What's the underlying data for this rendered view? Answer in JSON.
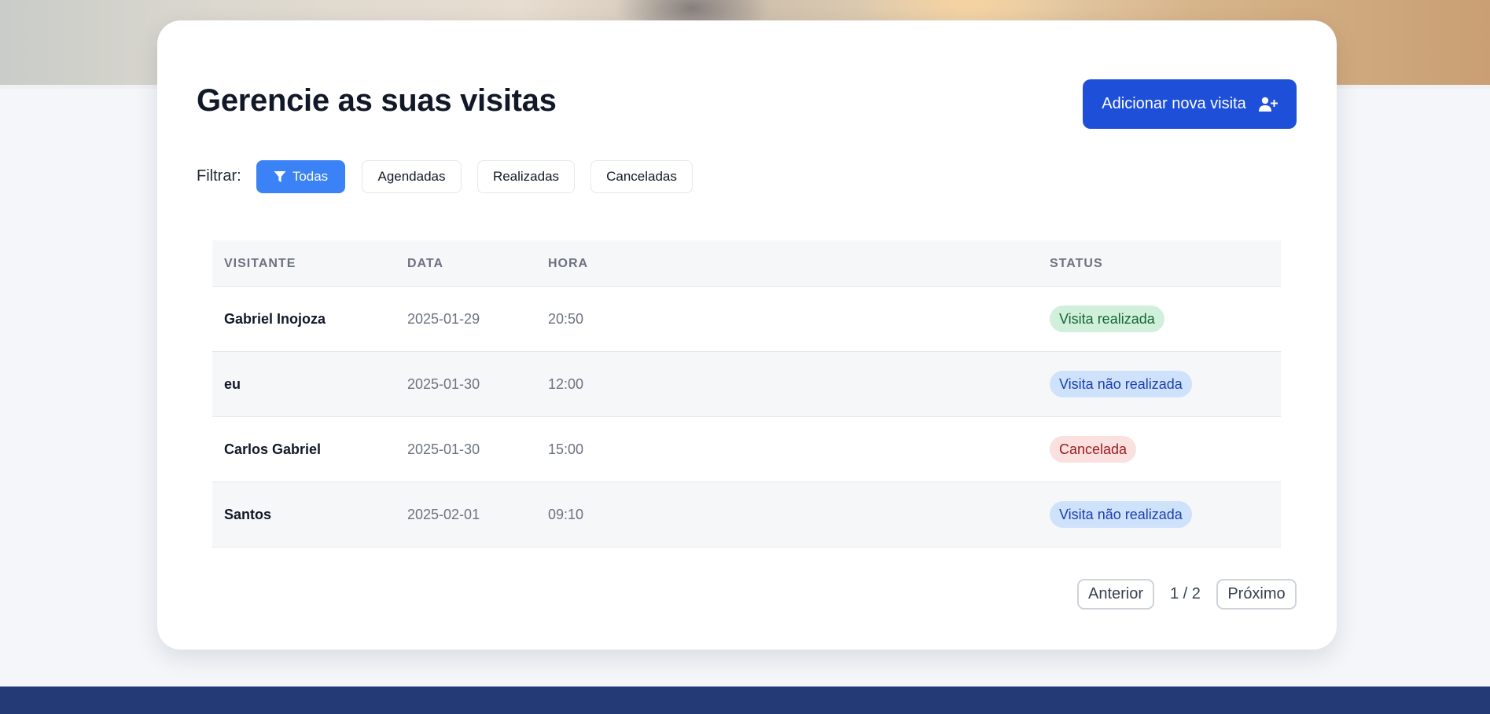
{
  "page": {
    "title": "Gerencie as suas visitas",
    "add_button": "Adicionar nova visita"
  },
  "filters": {
    "label": "Filtrar:",
    "options": [
      "Todas",
      "Agendadas",
      "Realizadas",
      "Canceladas"
    ],
    "active": "Todas"
  },
  "table": {
    "headers": [
      "VISITANTE",
      "DATA",
      "HORA",
      "STATUS"
    ],
    "rows": [
      {
        "visitante": "Gabriel Inojoza",
        "data": "2025-01-29",
        "hora": "20:50",
        "status": "Visita realizada",
        "status_type": "done"
      },
      {
        "visitante": "eu",
        "data": "2025-01-30",
        "hora": "12:00",
        "status": "Visita não realizada",
        "status_type": "pending"
      },
      {
        "visitante": "Carlos Gabriel",
        "data": "2025-01-30",
        "hora": "15:00",
        "status": "Cancelada",
        "status_type": "cancelled"
      },
      {
        "visitante": "Santos",
        "data": "2025-02-01",
        "hora": "09:10",
        "status": "Visita não realizada",
        "status_type": "pending"
      }
    ]
  },
  "pagination": {
    "prev": "Anterior",
    "info": "1 / 2",
    "next": "Próximo"
  },
  "colors": {
    "primary": "#1d4fd8",
    "filter_active": "#3b82f6",
    "footer": "#243a77",
    "done_bg": "#d1f0dc",
    "done_fg": "#166534",
    "pending_bg": "#cfe2fb",
    "pending_fg": "#1e40af",
    "cancelled_bg": "#fbe0e0",
    "cancelled_fg": "#991b1b"
  }
}
